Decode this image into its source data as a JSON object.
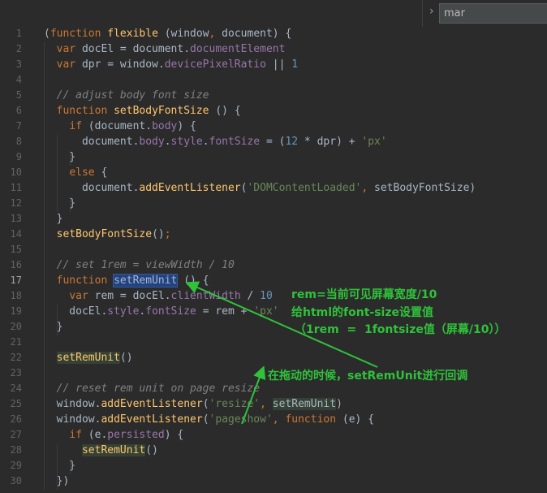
{
  "search": {
    "value": "mar",
    "chevron_icon": "chevron-right-icon"
  },
  "current_line": 17,
  "lines": [
    [
      [
        "",
        "("
      ],
      [
        "kw",
        "function"
      ],
      [
        "",
        " "
      ],
      [
        "fn",
        "flexible"
      ],
      [
        "",
        " (window"
      ],
      [
        "kw",
        ","
      ],
      [
        "",
        " document) {"
      ]
    ],
    [
      [
        "",
        "  "
      ],
      [
        "kw",
        "var"
      ],
      [
        "",
        " docEl = document."
      ],
      [
        "pr",
        "documentElement"
      ]
    ],
    [
      [
        "",
        "  "
      ],
      [
        "kw",
        "var"
      ],
      [
        "",
        " dpr = window."
      ],
      [
        "pr",
        "devicePixelRatio"
      ],
      [
        "",
        " || "
      ],
      [
        "nu",
        "1"
      ]
    ],
    [],
    [
      [
        "",
        "  "
      ],
      [
        "cm",
        "// adjust body font size"
      ]
    ],
    [
      [
        "",
        "  "
      ],
      [
        "kw",
        "function"
      ],
      [
        "",
        " "
      ],
      [
        "fn",
        "setBodyFontSize"
      ],
      [
        "",
        " () {"
      ]
    ],
    [
      [
        "",
        "    "
      ],
      [
        "kw",
        "if"
      ],
      [
        "",
        " (document."
      ],
      [
        "pr",
        "body"
      ],
      [
        "",
        ") {"
      ]
    ],
    [
      [
        "",
        "      document."
      ],
      [
        "pr",
        "body"
      ],
      [
        "",
        "."
      ],
      [
        "pr",
        "style"
      ],
      [
        "",
        "."
      ],
      [
        "pr",
        "fontSize"
      ],
      [
        "",
        " = ("
      ],
      [
        "nu",
        "12"
      ],
      [
        "",
        " * dpr) + "
      ],
      [
        "st",
        "'px'"
      ]
    ],
    [
      [
        "",
        "    }"
      ]
    ],
    [
      [
        "",
        "    "
      ],
      [
        "kw",
        "else"
      ],
      [
        "",
        " {"
      ]
    ],
    [
      [
        "",
        "      document."
      ],
      [
        "fn",
        "addEventListener"
      ],
      [
        "",
        "("
      ],
      [
        "st",
        "'DOMContentLoaded'"
      ],
      [
        "kw",
        ","
      ],
      [
        "",
        " setBodyFontSize)"
      ]
    ],
    [
      [
        "",
        "    }"
      ]
    ],
    [
      [
        "",
        "  }"
      ]
    ],
    [
      [
        "",
        "  "
      ],
      [
        "fn",
        "setBodyFontSize"
      ],
      [
        "",
        "()"
      ],
      [
        "kw",
        ";"
      ]
    ],
    [],
    [
      [
        "",
        "  "
      ],
      [
        "cm",
        "// set 1rem = viewWidth / 10"
      ]
    ],
    [
      [
        "",
        "  "
      ],
      [
        "kw",
        "function"
      ],
      [
        "",
        " "
      ],
      [
        "hlb",
        "setRemUnit"
      ],
      [
        "",
        " () {"
      ]
    ],
    [
      [
        "",
        "    "
      ],
      [
        "kw",
        "var"
      ],
      [
        "",
        " rem = docEl."
      ],
      [
        "pr",
        "clientWidth"
      ],
      [
        "",
        " / "
      ],
      [
        "nu",
        "10"
      ]
    ],
    [
      [
        "",
        "    docEl."
      ],
      [
        "pr",
        "style"
      ],
      [
        "",
        "."
      ],
      [
        "pr",
        "fontSize"
      ],
      [
        "",
        " = rem + "
      ],
      [
        "st",
        "'px'"
      ]
    ],
    [
      [
        "",
        "  }"
      ]
    ],
    [],
    [
      [
        "",
        "  "
      ],
      [
        "fn hlg",
        "setRemUnit"
      ],
      [
        "",
        "()"
      ]
    ],
    [],
    [
      [
        "",
        "  "
      ],
      [
        "cm",
        "// reset rem unit on page resize"
      ]
    ],
    [
      [
        "",
        "  window."
      ],
      [
        "fn",
        "addEventListener"
      ],
      [
        "",
        "("
      ],
      [
        "st",
        "'resize'"
      ],
      [
        "kw",
        ","
      ],
      [
        "",
        " "
      ],
      [
        "hlg",
        "setRemUnit"
      ],
      [
        "",
        ")"
      ]
    ],
    [
      [
        "",
        "  window."
      ],
      [
        "fn",
        "addEventListener"
      ],
      [
        "",
        "("
      ],
      [
        "st",
        "'pageshow'"
      ],
      [
        "kw",
        ","
      ],
      [
        "",
        " "
      ],
      [
        "kw",
        "function"
      ],
      [
        "",
        " (e) {"
      ]
    ],
    [
      [
        "",
        "    "
      ],
      [
        "kw",
        "if"
      ],
      [
        "",
        " (e."
      ],
      [
        "pr",
        "persisted"
      ],
      [
        "",
        ") {"
      ]
    ],
    [
      [
        "",
        "      "
      ],
      [
        "fn hlg",
        "setRemUnit"
      ],
      [
        "",
        "()"
      ]
    ],
    [
      [
        "",
        "    }"
      ]
    ],
    [
      [
        "",
        "  })"
      ]
    ]
  ],
  "annotations": {
    "line1": "rem=当前可见屏幕宽度/10",
    "line2": "给html的font-size设置值",
    "line3": "（1rem  =  1fontsize值（屏幕/10））",
    "line4": "在拖动的时候，setRemUnit进行回调",
    "color": "#2fc23a"
  },
  "colors": {
    "background": "#2b2b2b",
    "keyword": "#cc7832",
    "function": "#ffc66d",
    "property": "#9876aa",
    "number": "#6897bb",
    "string": "#6a8759",
    "comment": "#808080",
    "text": "#a9b7c6"
  }
}
